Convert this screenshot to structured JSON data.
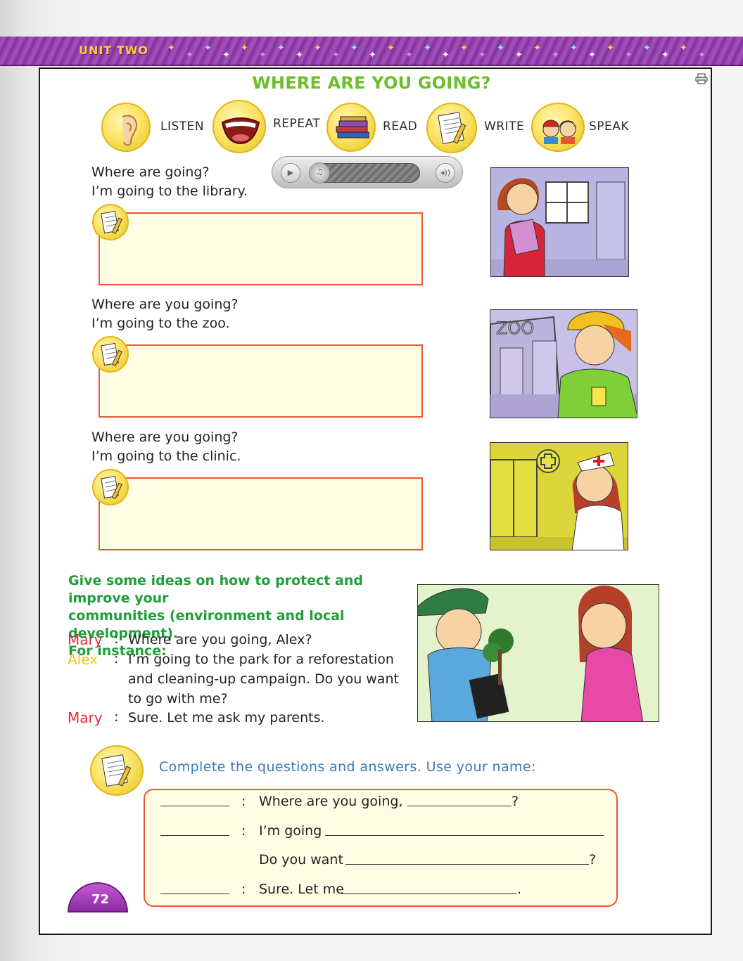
{
  "header": {
    "unit_label": "UNIT TWO"
  },
  "title": "WHERE ARE YOU GOING?",
  "skills": [
    {
      "label": "LISTEN",
      "icon": "ear-icon"
    },
    {
      "label": "REPEAT",
      "icon": "mouth-icon"
    },
    {
      "label": "READ",
      "icon": "books-icon"
    },
    {
      "label": "WRITE",
      "icon": "paper-pencil-icon"
    },
    {
      "label": "SPEAK",
      "icon": "kids-talking-icon"
    }
  ],
  "audio_player": {
    "play_icon": "▶",
    "note_icon": "♫",
    "volume_icon": "◂))"
  },
  "dialogs": [
    {
      "question": "Where are going?",
      "answer": "I’m going to the library."
    },
    {
      "question": "Where are you going?",
      "answer": "I’m going to the zoo."
    },
    {
      "question": "Where are you going?",
      "answer": "I’m going to the clinic."
    }
  ],
  "pictures": {
    "zoo_sign": "ZOO"
  },
  "ideas": {
    "line1": "Give some ideas on how to protect and improve your",
    "line2": "communities (environment and local development).",
    "line3": "For instance:"
  },
  "conversation": [
    {
      "speaker": "Mary",
      "color": "#e8283a",
      "lines": [
        "Where are you going, Alex?"
      ]
    },
    {
      "speaker": "Alex",
      "color": "#f5c023",
      "lines": [
        "I’m going to the park for a reforestation",
        "and cleaning-up campaign. Do you want",
        "to go with me?"
      ]
    },
    {
      "speaker": "Mary",
      "color": "#e8283a",
      "lines": [
        "Sure. Let me ask my parents."
      ]
    }
  ],
  "exercise": {
    "instruction": "Complete the questions and answers. Use your name:",
    "rows": [
      {
        "text": "Where are you going,",
        "end": "?"
      },
      {
        "text": "I’m going",
        "end": ""
      },
      {
        "text": "Do you want",
        "end": "?"
      },
      {
        "text": "Sure. Let me",
        "end": "."
      }
    ]
  },
  "page_number": "72",
  "colors": {
    "title_green": "#6cbf2a",
    "ideas_green": "#1f9e3a",
    "box_border": "#e85a33",
    "box_fill": "#fffde4",
    "banner_purple": "#8e3aa6"
  }
}
